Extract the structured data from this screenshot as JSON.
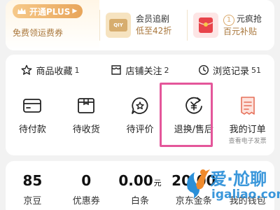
{
  "promo": {
    "plus_badge": "开通PLUS",
    "plus_subtitle": "免费领运费券",
    "member": {
      "title": "会员追剧",
      "desc": "低至42折",
      "thumb_text": "QIY"
    },
    "flash": {
      "tag": "1",
      "title": "元疯抢",
      "desc": "百元补贴"
    }
  },
  "stats": [
    {
      "label": "商品收藏",
      "count": "1",
      "icon": "star-icon"
    },
    {
      "label": "店铺关注",
      "count": "2",
      "icon": "shop-icon"
    },
    {
      "label": "浏览记录",
      "count": "51",
      "icon": "clock-icon"
    }
  ],
  "orders": [
    {
      "label": "待付款",
      "icon": "card-icon"
    },
    {
      "label": "待收货",
      "icon": "box-icon"
    },
    {
      "label": "待评价",
      "icon": "comment-icon"
    },
    {
      "label": "退换/售后",
      "icon": "yen-refund-icon"
    },
    {
      "label": "我的订单",
      "sub": "查看电子发票",
      "icon": "receipt-icon"
    }
  ],
  "wallet": [
    {
      "value": "85",
      "unit": "",
      "label": "京豆"
    },
    {
      "value": "0",
      "unit": "",
      "label": "优惠券"
    },
    {
      "value": "0.00",
      "unit": "元",
      "label": "白条"
    },
    {
      "value": "20.00",
      "unit": "",
      "label": "京东金条"
    },
    {
      "value": "",
      "unit": "",
      "label": "我的钱包"
    }
  ],
  "watermark": {
    "title": "爱·尬聊",
    "url": "igaliao.com"
  },
  "colors": {
    "accent": "#e4569a",
    "gold": "#a9773c",
    "brand_blue": "#2a8fd8"
  }
}
